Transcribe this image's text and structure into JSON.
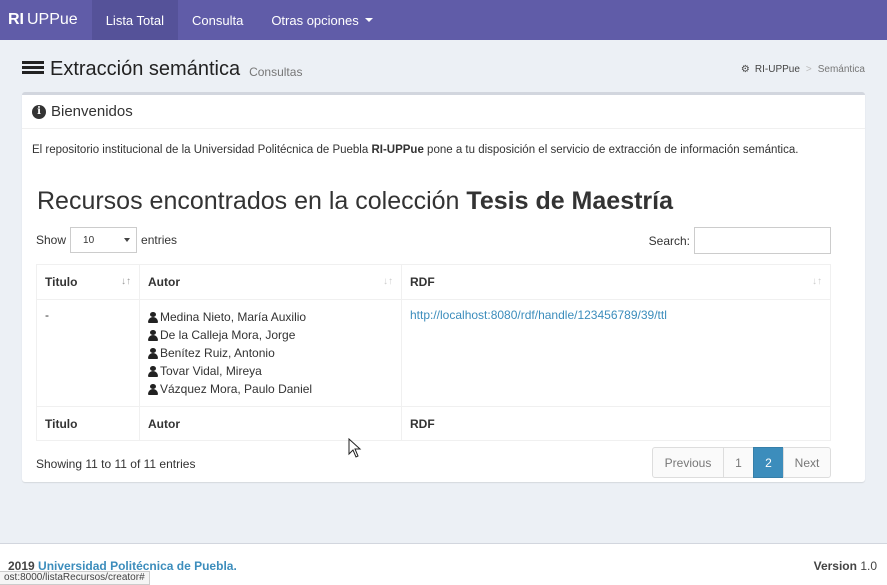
{
  "navbar": {
    "brand_bold": "RI",
    "brand_rest": "UPPue",
    "items": [
      {
        "label": "Lista Total"
      },
      {
        "label": "Consulta"
      },
      {
        "label": "Otras opciones"
      }
    ]
  },
  "header": {
    "title": "Extracción semántica",
    "subtitle": "Consultas",
    "breadcrumb": [
      "RI-UPPue",
      "Semántica"
    ]
  },
  "box": {
    "title": "Bienvenidos",
    "intro_pre": "El repositorio institucional de la Universidad Politécnica de Puebla ",
    "intro_bold": "RI-UPPue",
    "intro_post": " pone a tu disposición el servicio de extracción de información semántica.",
    "results_pre": "Recursos encontrados en la colección ",
    "results_bold": "Tesis de Maestría"
  },
  "table_controls": {
    "show_label": "Show",
    "entries_value": "10",
    "entries_label": "entries",
    "search_label": "Search:"
  },
  "table": {
    "columns": [
      "Titulo",
      "Autor",
      "RDF"
    ],
    "rows": [
      {
        "titulo": "-",
        "autores": [
          "Medina Nieto, María Auxilio",
          "De la Calleja Mora, Jorge",
          "Benítez Ruiz, Antonio",
          "Tovar Vidal, Mireya",
          "Vázquez Mora, Paulo Daniel"
        ],
        "rdf": "http://localhost:8080/rdf/handle/123456789/39/ttl"
      }
    ]
  },
  "pagination": {
    "info": "Showing 11 to 11 of 11 entries",
    "previous": "Previous",
    "pages": [
      "1",
      "2"
    ],
    "current": "2",
    "next": "Next"
  },
  "footer": {
    "copyright_year": "2019",
    "org": "Universidad Politécnica de Puebla.",
    "version_label": "Version",
    "version_value": "1.0"
  },
  "status_bar": {
    "url": "ost:8000/listaRecursos/creator#"
  },
  "colors": {
    "navbar": "#605ca8",
    "link": "#3c8dbc",
    "page_bg": "#ecf0f5"
  }
}
